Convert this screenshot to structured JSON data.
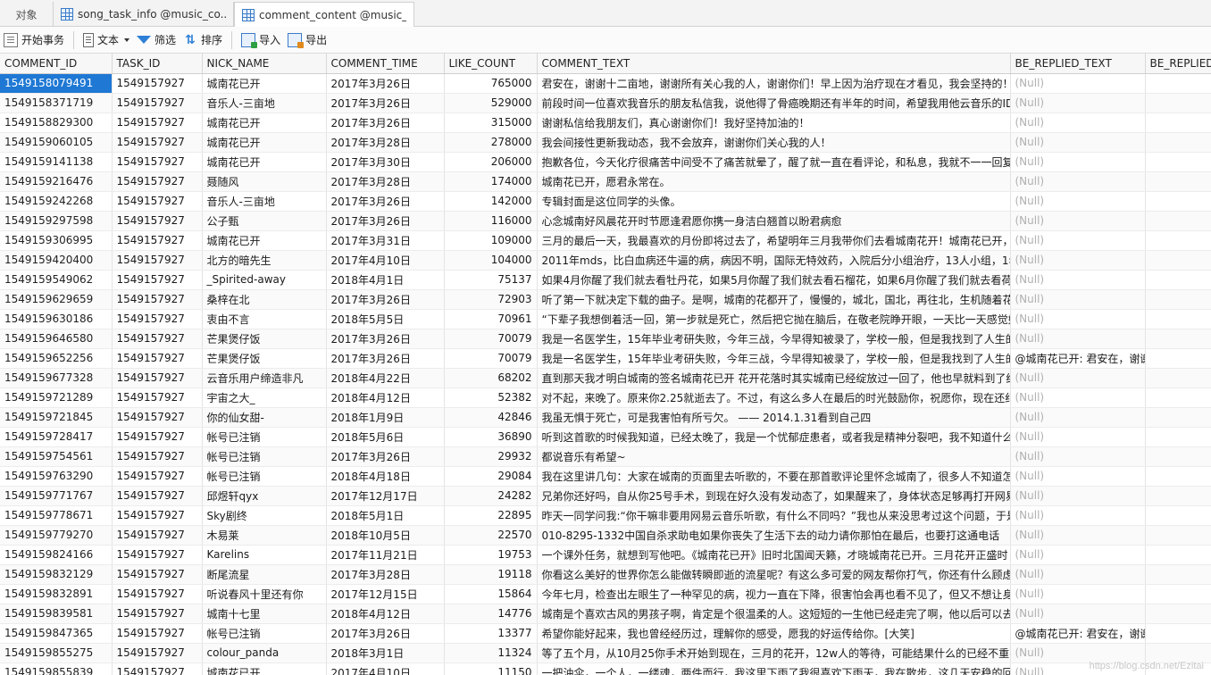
{
  "tabs": [
    {
      "label": "对象"
    },
    {
      "label": "song_task_info @music_co..."
    },
    {
      "label": "comment_content @music_c..."
    }
  ],
  "toolbar": {
    "begin_txn": "开始事务",
    "text": "文本",
    "filter": "筛选",
    "sort": "排序",
    "import": "导入",
    "export": "导出"
  },
  "columns": [
    "COMMENT_ID",
    "TASK_ID",
    "NICK_NAME",
    "COMMENT_TIME",
    "LIKE_COUNT",
    "COMMENT_TEXT",
    "BE_REPLIED_TEXT",
    "BE_REPLIED_"
  ],
  "rows": [
    [
      "1549158079491",
      "1549157927",
      "城南花已开",
      "2017年3月26日",
      "765000",
      "君安在，谢谢十二亩地，谢谢所有关心我的人，谢谢你们！早上因为治疗现在才看见，我会坚持的！",
      "(Null)",
      ""
    ],
    [
      "1549158371719",
      "1549157927",
      "音乐人-三亩地",
      "2017年3月26日",
      "529000",
      "前段时间一位喜欢我音乐的朋友私信我，说他得了骨癌晚期还有半年的时间，希望我用他云音乐的ID",
      "(Null)",
      ""
    ],
    [
      "1549158829300",
      "1549157927",
      "城南花已开",
      "2017年3月26日",
      "315000",
      "谢谢私信给我朋友们，真心谢谢你们！我好坚持加油的！",
      "(Null)",
      ""
    ],
    [
      "1549159060105",
      "1549157927",
      "城南花已开",
      "2017年3月28日",
      "278000",
      "我会间接性更新我动态，我不会放弃，谢谢你们关心我的人！",
      "(Null)",
      ""
    ],
    [
      "1549159141138",
      "1549157927",
      "城南花已开",
      "2017年3月30日",
      "206000",
      "抱歉各位，今天化疗很痛苦中间受不了痛苦就晕了，醒了就一直在看评论，和私息，我就不一一回复",
      "(Null)",
      ""
    ],
    [
      "1549159216476",
      "1549157927",
      "聂随风",
      "2017年3月28日",
      "174000",
      "城南花已开，愿君永常在。",
      "(Null)",
      ""
    ],
    [
      "1549159242268",
      "1549157927",
      "音乐人-三亩地",
      "2017年3月26日",
      "142000",
      "专辑封面是这位同学的头像。",
      "(Null)",
      ""
    ],
    [
      "1549159297598",
      "1549157927",
      "公子甄",
      "2017年3月26日",
      "116000",
      "心念城南好风晨花开时节愿逢君愿你携一身洁白翘首以盼君病愈",
      "(Null)",
      ""
    ],
    [
      "1549159306995",
      "1549157927",
      "城南花已开",
      "2017年3月31日",
      "109000",
      "三月的最后一天，我最喜欢的月份即将过去了，希望明年三月我带你们去看城南花开！城南花已开，",
      "(Null)",
      ""
    ],
    [
      "1549159420400",
      "1549157927",
      "北方的暗先生",
      "2017年4月10日",
      "104000",
      "2011年mds，比白血病还牛逼的病，病因不明，国际无特效药，入院后分小组治疗，13人小组，1年",
      "(Null)",
      ""
    ],
    [
      "1549159549062",
      "1549157927",
      "_Spirited-away",
      "2018年4月1日",
      "75137",
      "如果4月你醒了我们就去看牡丹花，如果5月你醒了我们就去看石榴花，如果6月你醒了我们就去看荷花",
      "(Null)",
      ""
    ],
    [
      "1549159629659",
      "1549157927",
      "桑梓在北",
      "2017年3月26日",
      "72903",
      "听了第一下就决定下载的曲子。是啊，城南的花都开了，慢慢的，城北，国北，再往北，生机随着花",
      "(Null)",
      ""
    ],
    [
      "1549159630186",
      "1549157927",
      "衷由不言",
      "2018年5月5日",
      "70961",
      "“下辈子我想倒着活一回，第一步就是死亡，然后把它抛在脑后，在敬老院睁开眼，一天比一天感觉好，直",
      "(Null)",
      ""
    ],
    [
      "1549159646580",
      "1549157927",
      "芒果煲仔饭",
      "2017年3月26日",
      "70079",
      "我是一名医学生，15年毕业考研失败，今年三战，今早得知被录了，学校一般，但是我找到了人生的",
      "(Null)",
      ""
    ],
    [
      "1549159652256",
      "1549157927",
      "芒果煲仔饭",
      "2017年3月26日",
      "70079",
      "我是一名医学生，15年毕业考研失败，今年三战，今早得知被录了，学校一般，但是我找到了人生的",
      "@城南花已开: 君安在，谢谢",
      ""
    ],
    [
      "1549159677328",
      "1549157927",
      "云音乐用户缔造非凡",
      "2018年4月22日",
      "68202",
      "直到那天我才明白城南的签名城南花已开 花开花落时其实城南已经绽放过一回了，他也早就料到了结",
      "(Null)",
      ""
    ],
    [
      "1549159721289",
      "1549157927",
      "宇宙之大_",
      "2018年4月12日",
      "52382",
      "对不起，来晚了。原来你2.25就逝去了。不过，有这么多人在最后的时光鼓励你，祝愿你，现在还纪",
      "(Null)",
      ""
    ],
    [
      "1549159721845",
      "1549157927",
      "你的仙女甜-",
      "2018年1月9日",
      "42846",
      "我虽无惧于死亡，可是我害怕有所亏欠。                              —— 2014.1.31看到自己四",
      "(Null)",
      ""
    ],
    [
      "1549159728417",
      "1549157927",
      "帐号已注销",
      "2018年5月6日",
      "36890",
      "听到这首歌的时候我知道，已经太晚了，我是一个忧郁症患者，或者我是精神分裂吧，我不知道什么",
      "(Null)",
      ""
    ],
    [
      "1549159754561",
      "1549157927",
      "帐号已注销",
      "2017年3月26日",
      "29932",
      "都说音乐有希望~",
      "(Null)",
      ""
    ],
    [
      "1549159763290",
      "1549157927",
      "帐号已注销",
      "2018年4月18日",
      "29084",
      "我在这里讲几句：大家在城南的页面里去听歌的，不要在那首歌评论里怀念城南了，很多人不知道怎",
      "(Null)",
      ""
    ],
    [
      "1549159771767",
      "1549157927",
      "邱煜轩qyx",
      "2017年12月17日",
      "24282",
      "兄弟你还好吗，自从你25号手术，到现在好久没有发动态了，如果醒来了，身体状态足够再打开网易",
      "(Null)",
      ""
    ],
    [
      "1549159778671",
      "1549157927",
      "Sky剧终",
      "2018年5月1日",
      "22895",
      "昨天一同学问我:“你干嘛非要用网易云音乐听歌，有什么不同吗？”我也从来没思考过这个问题，于是",
      "(Null)",
      ""
    ],
    [
      "1549159779270",
      "1549157927",
      "木易莱",
      "2018年10月5日",
      "22570",
      "010-8295-1332中国自杀求助电如果你丧失了生活下去的动力请你那怕在最后，也要打这通电话",
      "(Null)",
      ""
    ],
    [
      "1549159824166",
      "1549157927",
      "Karelins",
      "2017年11月21日",
      "19753",
      "一个课外任务，就想到写他吧。《城南花已开》旧时北国闻天籁，才晓城南花已开。三月花开正盛时",
      "(Null)",
      ""
    ],
    [
      "1549159832129",
      "1549157927",
      "断尾流星",
      "2017年3月28日",
      "19118",
      "你看这么美好的世界你怎么能做转瞬即逝的流星呢？有这么多可爱的网友帮你打气，你还有什么顾虑",
      "(Null)",
      ""
    ],
    [
      "1549159832891",
      "1549157927",
      "听说春风十里还有你",
      "2017年12月15日",
      "15864",
      "今年七月，检查出左眼生了一种罕见的病，视力一直在下降，很害怕会再也看不见了，但又不想让身",
      "(Null)",
      ""
    ],
    [
      "1549159839581",
      "1549157927",
      "城南十七里",
      "2018年4月12日",
      "14776",
      "城南是个喜欢古风的男孩子啊，肯定是个很温柔的人。这短短的一生他已经走完了啊，他以后可以去",
      "(Null)",
      ""
    ],
    [
      "1549159847365",
      "1549157927",
      "帐号已注销",
      "2017年3月26日",
      "13377",
      "希望你能好起来，我也曾经经历过，理解你的感受，愿我的好运传给你。[大笑]",
      "@城南花已开: 君安在，谢谢",
      ""
    ],
    [
      "1549159855275",
      "1549157927",
      "colour_panda",
      "2018年3月1日",
      "11324",
      "等了五个月，从10月25你手术开始到现在，三月的花开，12w人的等待，可能结果什么的已经不重要",
      "(Null)",
      ""
    ],
    [
      "1549159855839",
      "1549157927",
      "城南花已开",
      "2017年4月10日",
      "11150",
      "一把油伞，一个人，一缕魂，两件而行，我这里下雨了我很喜欢下雨天，我在散步，这几天安稳的回",
      "(Null)",
      ""
    ]
  ],
  "watermark": "https://blog.csdn.net/Ezitai"
}
